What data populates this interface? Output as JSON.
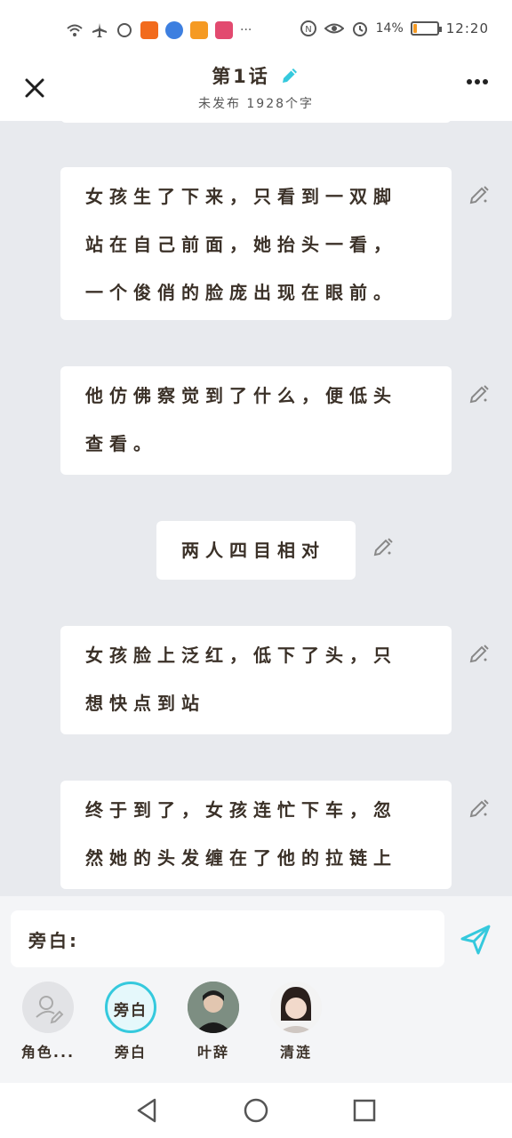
{
  "status_bar": {
    "battery": "14%",
    "battery_level": 0.14,
    "time": "12:20",
    "more_dots": "···"
  },
  "header": {
    "title": "第1话",
    "subtitle": "未发布 1928个字"
  },
  "cards": [
    {
      "lines": [
        "女孩生了下来，只看到一双脚",
        "站在自己前面，她抬头一看，",
        "一个俊俏的脸庞出现在眼前。"
      ]
    },
    {
      "lines": [
        "他仿佛察觉到了什么，便低头",
        "查看。"
      ]
    },
    {
      "lines": [
        "两人四目相对"
      ]
    },
    {
      "lines": [
        "女孩脸上泛红，低下了头，只",
        "想快点到站"
      ]
    },
    {
      "lines": [
        "终于到了，女孩连忙下车，忽",
        "然她的头发缠在了他的拉链上"
      ]
    }
  ],
  "composer": {
    "input_value": "旁白:"
  },
  "roles": [
    {
      "label": "角色...",
      "icon": "add-role-icon"
    },
    {
      "label": "旁白",
      "avatar_text": "旁白",
      "accent": "#35c9dd"
    },
    {
      "label": "叶辞",
      "icon": "photo-avatar"
    },
    {
      "label": "清涟",
      "icon": "photo-avatar"
    }
  ],
  "colors": {
    "accent": "#35c9dd",
    "background": "#e8eaee",
    "text": "#3b3128"
  }
}
